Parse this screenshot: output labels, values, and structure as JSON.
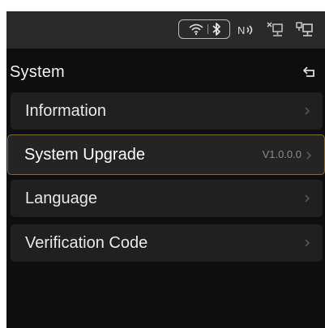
{
  "status_bar": {
    "icons": [
      "wifi-icon",
      "bluetooth-icon",
      "nfc-icon",
      "network-disconnected-icon",
      "network-connected-icon"
    ]
  },
  "header": {
    "title": "System",
    "back_icon": "back-icon"
  },
  "menu": {
    "items": [
      {
        "label": "Information",
        "value": "",
        "selected": false
      },
      {
        "label": "System Upgrade",
        "value": "V1.0.0.0",
        "selected": true
      },
      {
        "label": "Language",
        "value": "",
        "selected": false
      },
      {
        "label": "Verification Code",
        "value": "",
        "selected": false
      }
    ]
  },
  "colors": {
    "background": "#0e0e0e",
    "status_bar": "#2a2a2a",
    "item_background": "#202020",
    "selected_border": "#8a6a2a",
    "text": "#e8e8e8",
    "muted": "#8a8a8a"
  }
}
